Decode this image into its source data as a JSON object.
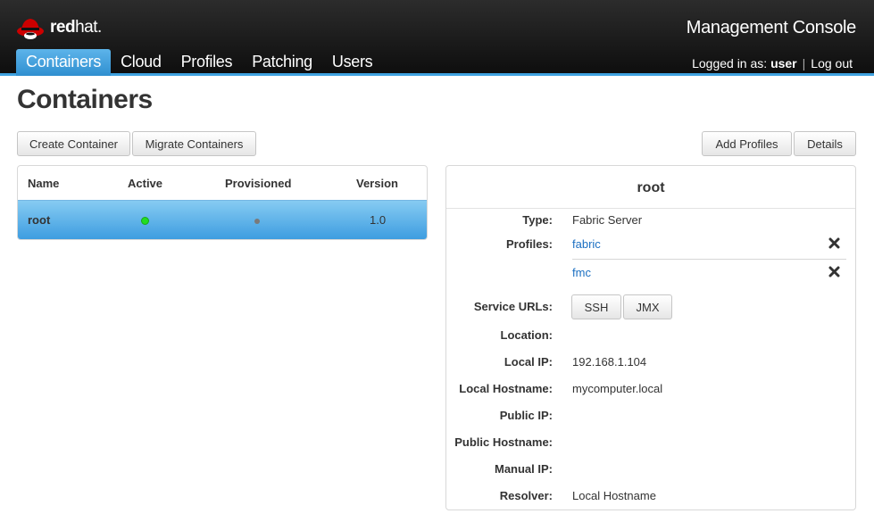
{
  "header": {
    "brand": {
      "bold": "red",
      "light": "hat."
    },
    "console_title": "Management Console",
    "nav": [
      "Containers",
      "Cloud",
      "Profiles",
      "Patching",
      "Users"
    ],
    "active_nav": "Containers",
    "user": {
      "prefix": "Logged in as:",
      "name": "user",
      "separator": "|",
      "logout": "Log out"
    },
    "accent_color": "#3fa2e0"
  },
  "page": {
    "title": "Containers"
  },
  "toolbar": {
    "create": "Create Container",
    "migrate": "Migrate Containers",
    "add_profiles": "Add Profiles",
    "details": "Details"
  },
  "table": {
    "columns": [
      "Name",
      "Active",
      "Provisioned",
      "Version"
    ],
    "rows": [
      {
        "name": "root",
        "active": "green-dot-icon",
        "provisioned": "gray-dot-icon",
        "version": "1.0",
        "selected": true
      }
    ]
  },
  "details": {
    "title": "root",
    "type_label": "Type:",
    "type_value": "Fabric Server",
    "profiles_label": "Profiles:",
    "profiles": [
      "fabric",
      "fmc"
    ],
    "service_urls_label": "Service URLs:",
    "service_urls": [
      "SSH",
      "JMX"
    ],
    "location_label": "Location:",
    "location_value": "",
    "local_ip_label": "Local IP:",
    "local_ip_value": "192.168.1.104",
    "local_hostname_label": "Local Hostname:",
    "local_hostname_value": "mycomputer.local",
    "public_ip_label": "Public IP:",
    "public_ip_value": "",
    "public_hostname_label": "Public Hostname:",
    "public_hostname_value": "",
    "manual_ip_label": "Manual IP:",
    "manual_ip_value": "",
    "resolver_label": "Resolver:",
    "resolver_value": "Local Hostname"
  }
}
